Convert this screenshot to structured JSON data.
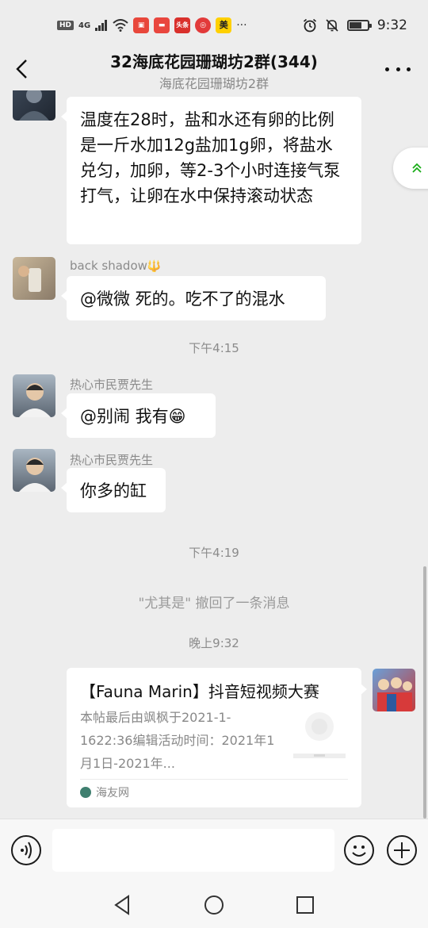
{
  "status_bar": {
    "hd_badge": "HD",
    "network": "4G",
    "time": "9:32",
    "battery_level": 0.7,
    "apps": [
      {
        "name": "red-app-icon",
        "color": "#e8473b",
        "label": ""
      },
      {
        "name": "red-app-icon",
        "color": "#e9463e",
        "label": ""
      },
      {
        "name": "toutiao-icon",
        "color": "#d9302c",
        "label": "头条"
      },
      {
        "name": "red-circle-app-icon",
        "color": "#e23a3a",
        "label": ""
      },
      {
        "name": "meituan-icon",
        "color": "#ffd000",
        "label": "美"
      }
    ],
    "overflow": "···"
  },
  "header": {
    "title": "32海底花园珊瑚坊2群(344)",
    "subtitle": "海底花园珊瑚坊2群"
  },
  "messages": [
    {
      "type": "text",
      "sender": "",
      "text": "温度在28时，盐和水还有卵的比例是一斤水加12g盐加1g卵，将盐水兑匀，加卵，等2-3个小时连接气泵打气，让卵在水中保持滚动状态"
    },
    {
      "type": "text",
      "sender": "back shadow",
      "sender_badge": "🔱",
      "text": "@微微   死的。吃不了的混水"
    },
    {
      "type": "time",
      "text": "下午4:15"
    },
    {
      "type": "text",
      "sender": "热心市民贾先生",
      "text": "@别闹  我有😁"
    },
    {
      "type": "text",
      "sender": "热心市民贾先生",
      "text": "你多的缸"
    },
    {
      "type": "time",
      "text": "下午4:19"
    },
    {
      "type": "system",
      "text": "\"尤其是\" 撤回了一条消息"
    },
    {
      "type": "time",
      "text": "晚上9:32"
    }
  ],
  "link_card": {
    "title": "【Fauna Marin】抖音短视频大赛",
    "description": "本帖最后由飒枫于2021-1-1622:36编辑活动时间：2021年1月1日-2021年...",
    "source": "海友网"
  },
  "input_bar": {
    "placeholder": ""
  },
  "colors": {
    "background": "#ededed",
    "bubble": "#ffffff",
    "meta_text": "#8b8b8b"
  }
}
